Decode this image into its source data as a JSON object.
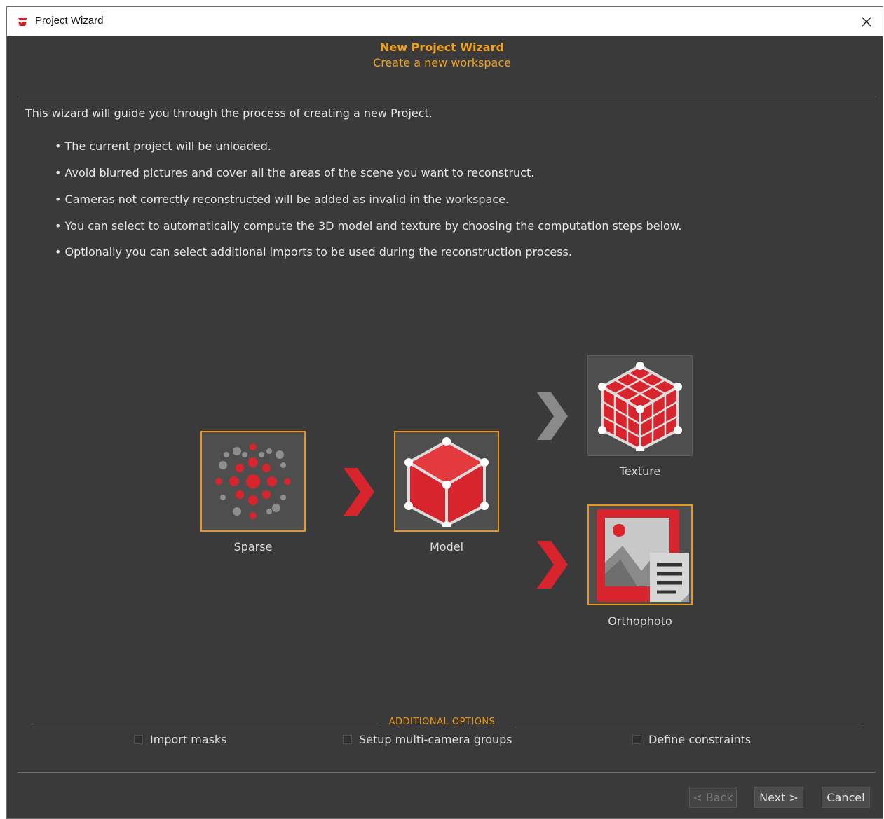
{
  "window": {
    "title": "Project Wizard"
  },
  "header": {
    "title": "New Project Wizard",
    "subtitle": "Create a new workspace"
  },
  "intro": {
    "text": "This wizard will guide you through the process of creating a new Project.",
    "bullets": [
      "• The current project will be unloaded.",
      "• Avoid blurred pictures and cover all the areas of the scene you want to reconstruct.",
      "• Cameras not correctly reconstructed will be added as invalid in the workspace.",
      "• You can select to automatically compute the 3D model and texture by choosing the computation steps below.",
      "• Optionally you can select additional imports to be used during the reconstruction process."
    ]
  },
  "steps": {
    "sparse": {
      "label": "Sparse",
      "selected": true
    },
    "model": {
      "label": "Model",
      "selected": true
    },
    "texture": {
      "label": "Texture",
      "selected": false
    },
    "orthophoto": {
      "label": "Orthophoto",
      "selected": true
    }
  },
  "options": {
    "legend": "ADDITIONAL OPTIONS",
    "import_masks": {
      "label": "Import masks",
      "checked": false
    },
    "multi_camera": {
      "label": "Setup multi-camera groups",
      "checked": false
    },
    "constraints": {
      "label": "Define constraints",
      "checked": false
    }
  },
  "buttons": {
    "back": "< Back",
    "next": "Next >",
    "cancel": "Cancel"
  },
  "colors": {
    "accent": "#e8961e",
    "red": "#d8242c",
    "arrow_inactive": "#8a8a8a",
    "background": "#3a3a3a"
  }
}
